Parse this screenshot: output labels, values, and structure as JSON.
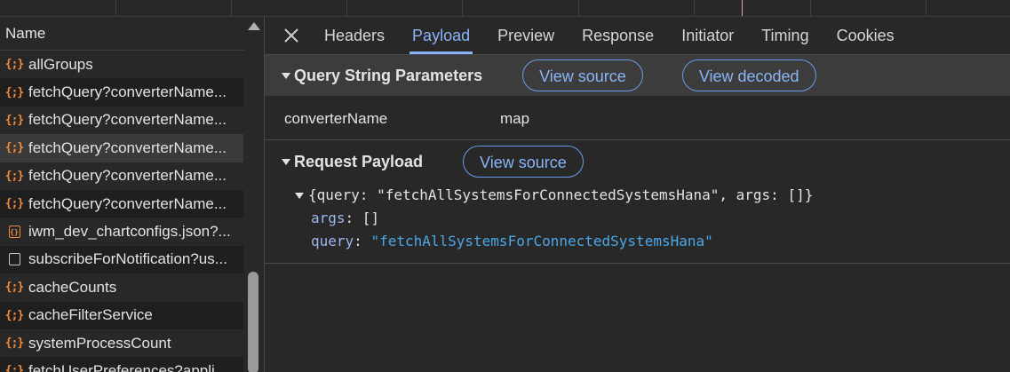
{
  "list": {
    "header": "Name",
    "rows": [
      {
        "label": "allGroups",
        "icon": "json-braces-icon"
      },
      {
        "label": "fetchQuery?converterName...",
        "icon": "json-braces-icon"
      },
      {
        "label": "fetchQuery?converterName...",
        "icon": "json-braces-icon"
      },
      {
        "label": "fetchQuery?converterName...",
        "icon": "json-braces-icon",
        "selected": true
      },
      {
        "label": "fetchQuery?converterName...",
        "icon": "json-braces-icon"
      },
      {
        "label": "fetchQuery?converterName...",
        "icon": "json-braces-icon"
      },
      {
        "label": "iwm_dev_chartconfigs.json?...",
        "icon": "json-file-icon"
      },
      {
        "label": "subscribeForNotification?us...",
        "icon": "document-icon"
      },
      {
        "label": "cacheCounts",
        "icon": "json-braces-icon"
      },
      {
        "label": "cacheFilterService",
        "icon": "json-braces-icon"
      },
      {
        "label": "systemProcessCount",
        "icon": "json-braces-icon"
      },
      {
        "label": "fetchUserPreferences?appli...",
        "icon": "json-braces-icon"
      }
    ]
  },
  "tabs": [
    "Headers",
    "Payload",
    "Preview",
    "Response",
    "Initiator",
    "Timing",
    "Cookies"
  ],
  "active_tab": "Payload",
  "query_section": {
    "title": "Query String Parameters",
    "view_source": "View source",
    "view_decoded": "View decoded",
    "param_key": "converterName",
    "param_value": "map"
  },
  "payload_section": {
    "title": "Request Payload",
    "view_source": "View source",
    "summary": "{query: \"fetchAllSystemsForConnectedSystemsHana\", args: []}",
    "args_key": "args",
    "args_value": "[]",
    "query_key": "query",
    "query_value": "\"fetchAllSystemsForConnectedSystemsHana\""
  },
  "colors": {
    "accent": "#8ab4f8",
    "json_icon": "#f28b3c",
    "string_value": "#4aa7e8"
  }
}
